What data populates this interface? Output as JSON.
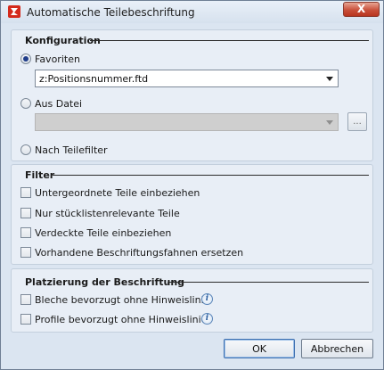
{
  "window": {
    "title": "Automatische Teilebeschriftung",
    "close_label": "X"
  },
  "konfiguration": {
    "title": "Konfiguration",
    "favoriten_label": "Favoriten",
    "favoriten_selected": true,
    "favoriten_value": "z:Positionsnummer.ftd",
    "aus_datei_label": "Aus Datei",
    "aus_datei_selected": false,
    "aus_datei_value": "",
    "browse_label": "...",
    "nach_teilefilter_label": "Nach Teilefilter",
    "nach_teilefilter_selected": false
  },
  "filter": {
    "title": "Filter",
    "options": [
      {
        "label": "Untergeordnete Teile einbeziehen",
        "checked": false
      },
      {
        "label": "Nur stücklistenrelevante Teile",
        "checked": false
      },
      {
        "label": "Verdeckte Teile einbeziehen",
        "checked": false
      },
      {
        "label": "Vorhandene Beschriftungsfahnen ersetzen",
        "checked": false
      }
    ]
  },
  "platzierung": {
    "title": "Platzierung der Beschriftung",
    "options": [
      {
        "label": "Bleche bevorzugt ohne Hinweislinie",
        "checked": false
      },
      {
        "label": "Profile bevorzugt ohne Hinweislinie",
        "checked": false
      }
    ],
    "info_symbol": "i"
  },
  "buttons": {
    "ok_label": "OK",
    "cancel_label": "Abbrechen"
  },
  "icons": {
    "app": "hicad-app-icon",
    "close": "close-icon",
    "info": "info-icon",
    "dropdown": "chevron-down-icon"
  },
  "colors": {
    "accent": "#1f3d8a",
    "close_button": "#c9503a",
    "app_icon": "#d42a1c"
  }
}
